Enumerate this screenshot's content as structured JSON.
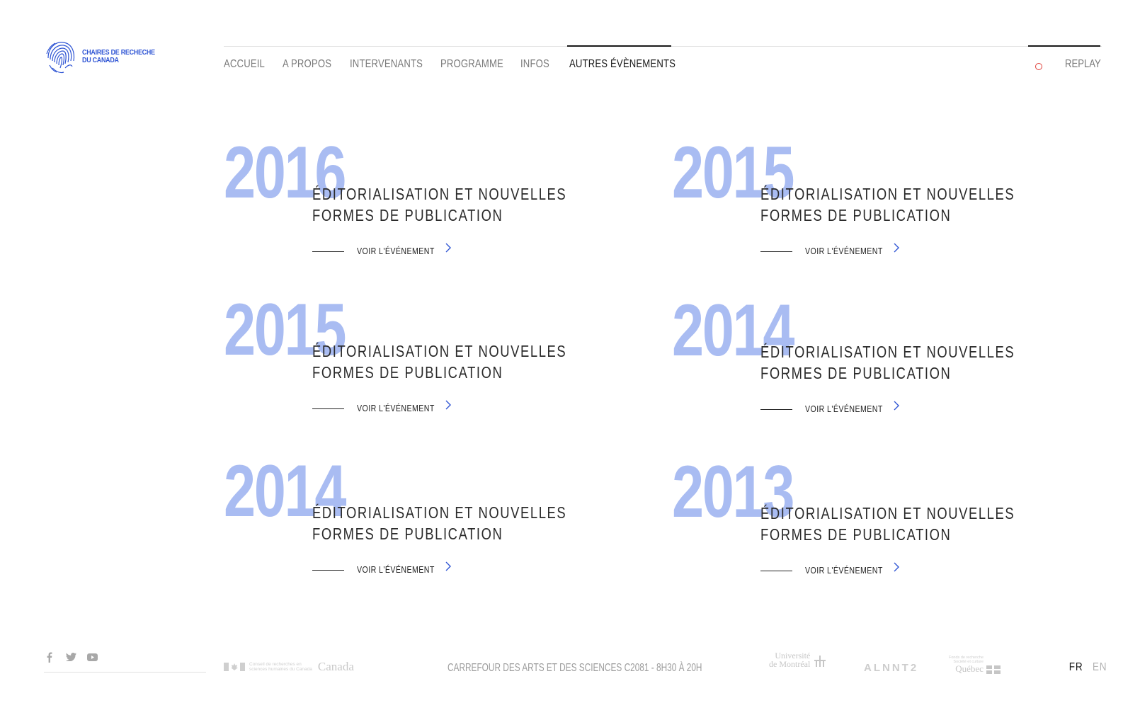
{
  "brand": {
    "name_line1": "Chaires de recheche",
    "name_line2": "du Canada",
    "color": "#2f55d4"
  },
  "nav": {
    "items": [
      {
        "label": "ACCUEIL"
      },
      {
        "label": "A PROPOS"
      },
      {
        "label": "INTERVENANTS"
      },
      {
        "label": "PROGRAMME"
      },
      {
        "label": "INFOS"
      },
      {
        "label": "AUTRES ÉVÈNEMENTS"
      }
    ],
    "active_index": 5,
    "replay_label": "REPLAY"
  },
  "events": [
    {
      "year": "2016",
      "title": "ÉDITORIALISATION ET NOUVELLES FORMES DE PUBLICATION",
      "link_label": "VOIR L'ÉVÉNEMENT"
    },
    {
      "year": "2015",
      "title": "ÉDITORIALISATION ET NOUVELLES FORMES DE PUBLICATION",
      "link_label": "VOIR L'ÉVÉNEMENT"
    },
    {
      "year": "2015",
      "title": "ÉDITORIALISATION ET NOUVELLES FORMES DE PUBLICATION",
      "link_label": "VOIR L'ÉVÉNEMENT"
    },
    {
      "year": "2014",
      "title": "ÉDITORIALISATION ET NOUVELLES FORMES DE PUBLICATION",
      "link_label": "VOIR L'ÉVÉNEMENT"
    },
    {
      "year": "2014",
      "title": "ÉDITORIALISATION ET NOUVELLES FORMES DE PUBLICATION",
      "link_label": "VOIR L'ÉVÉNEMENT"
    },
    {
      "year": "2013",
      "title": "ÉDITORIALISATION ET NOUVELLES FORMES DE PUBLICATION",
      "link_label": "VOIR L'ÉVÉNEMENT"
    }
  ],
  "footer": {
    "social": [
      {
        "icon": "facebook-icon",
        "glyph": "f"
      },
      {
        "icon": "twitter-icon",
        "glyph": "🐦"
      },
      {
        "icon": "youtube-icon",
        "glyph": "▶"
      }
    ],
    "partners": {
      "crsh_small_1": "Conseil de recherches en",
      "crsh_small_2": "sciences humaines du Canada",
      "canada": "Canada",
      "udem_1": "Université",
      "udem_2": "de Montréal",
      "alnt2": "ALNNT2",
      "frq_small_1": "Fonds de recherche",
      "frq_small_2": "Société et culture",
      "quebec": "Québec"
    },
    "venue": "CARREFOUR DES ARTS ET DES SCIENCES C2081 - 8H30 À 20H",
    "lang_fr": "FR",
    "lang_en": "EN"
  },
  "colors": {
    "year": "#a9bcf2",
    "chevron": "#2f55d4",
    "replay_dot": "#e0403a"
  }
}
